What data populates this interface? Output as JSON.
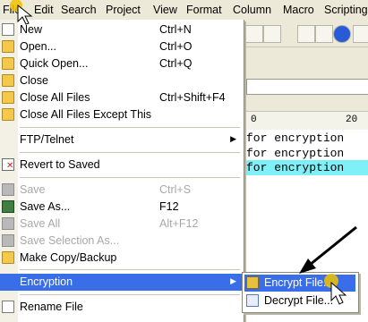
{
  "menubar": {
    "items": [
      "File",
      "Edit",
      "Search",
      "Project",
      "View",
      "Format",
      "Column",
      "Macro",
      "Scripting"
    ]
  },
  "file_menu": {
    "items": [
      {
        "label": "New",
        "shortcut": "Ctrl+N",
        "icon": "new-document-icon",
        "enabled": true
      },
      {
        "label": "Open...",
        "shortcut": "Ctrl+O",
        "icon": "open-folder-icon",
        "enabled": true
      },
      {
        "label": "Quick Open...",
        "shortcut": "Ctrl+Q",
        "icon": "quick-open-icon",
        "enabled": true
      },
      {
        "label": "Close",
        "shortcut": "",
        "icon": "close-folder-icon",
        "enabled": true
      },
      {
        "label": "Close All Files",
        "shortcut": "Ctrl+Shift+F4",
        "icon": "close-all-icon",
        "enabled": true
      },
      {
        "label": "Close All Files Except This",
        "shortcut": "",
        "icon": "close-all-except-icon",
        "enabled": true
      },
      {
        "label": "FTP/Telnet",
        "shortcut": "",
        "icon": "",
        "enabled": true,
        "submenu": true
      },
      {
        "label": "Revert to Saved",
        "shortcut": "",
        "icon": "revert-icon",
        "enabled": true
      },
      {
        "label": "Save",
        "shortcut": "Ctrl+S",
        "icon": "save-icon",
        "enabled": false
      },
      {
        "label": "Save As...",
        "shortcut": "F12",
        "icon": "save-as-icon",
        "enabled": true
      },
      {
        "label": "Save All",
        "shortcut": "Alt+F12",
        "icon": "save-all-icon",
        "enabled": false
      },
      {
        "label": "Save Selection As...",
        "shortcut": "",
        "icon": "save-selection-icon",
        "enabled": false
      },
      {
        "label": "Make Copy/Backup",
        "shortcut": "",
        "icon": "backup-icon",
        "enabled": true
      },
      {
        "label": "Encryption",
        "shortcut": "",
        "icon": "",
        "enabled": true,
        "submenu": true,
        "highlighted": true
      },
      {
        "label": "Rename File",
        "shortcut": "",
        "icon": "rename-icon",
        "enabled": true
      }
    ]
  },
  "encryption_submenu": {
    "items": [
      {
        "label": "Encrypt File...",
        "icon": "encrypt-lock-icon",
        "highlighted": true
      },
      {
        "label": "Decrypt File...",
        "icon": "decrypt-icon",
        "highlighted": false
      }
    ]
  },
  "ruler": {
    "left": "0",
    "right": "20"
  },
  "editor": {
    "lines": [
      "for encryption",
      "for encryption",
      "for encryption"
    ],
    "selected_line": 2
  },
  "colors": {
    "highlight": "#3a6ee8",
    "selection": "#80f0f8"
  }
}
